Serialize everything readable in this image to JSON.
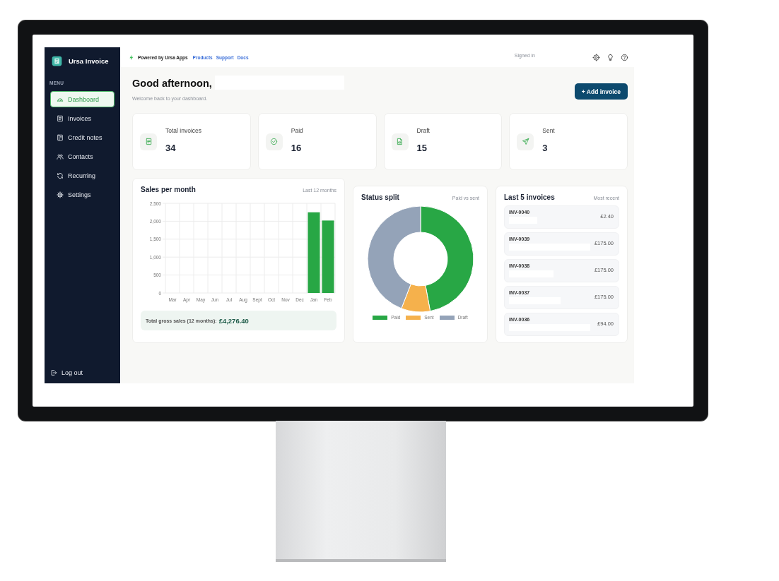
{
  "sidebar": {
    "app_name": "Ursa Invoice",
    "section_label": "MENU",
    "items": [
      {
        "label": "Dashboard",
        "selected": true
      },
      {
        "label": "Invoices",
        "selected": false
      },
      {
        "label": "Credit notes",
        "selected": false
      },
      {
        "label": "Contacts",
        "selected": false
      },
      {
        "label": "Recurring",
        "selected": false
      },
      {
        "label": "Settings",
        "selected": false
      }
    ],
    "logout": "Log out"
  },
  "top_bar": {
    "powered_by": "Powered by Ursa Apps",
    "links": [
      "Products",
      "Support",
      "Docs"
    ],
    "signed_in": "Signed in"
  },
  "header": {
    "greeting": "Good afternoon,",
    "subtitle": "Welcome back to your dashboard.",
    "add_button": "+ Add invoice"
  },
  "stats": [
    {
      "label": "Total invoices",
      "value": "34"
    },
    {
      "label": "Paid",
      "value": "16"
    },
    {
      "label": "Draft",
      "value": "15"
    },
    {
      "label": "Sent",
      "value": "3"
    }
  ],
  "sales": {
    "title": "Sales per month",
    "subtitle": "Last 12 months",
    "total_label": "Total gross sales (12 months):",
    "total_value": "£4,276.40",
    "chart_data": {
      "type": "bar",
      "categories": [
        "Mar",
        "Apr",
        "May",
        "Jun",
        "Jul",
        "Aug",
        "Sept",
        "Oct",
        "Nov",
        "Dec",
        "Jan",
        "Feb"
      ],
      "series": [
        {
          "color": "#28a745",
          "values": [
            0,
            0,
            0,
            0,
            0,
            0,
            0,
            0,
            0,
            0,
            2250,
            2020
          ]
        }
      ],
      "ylim": [
        0,
        2500
      ],
      "grid": true,
      "yticks": [
        {
          "value": 0,
          "label": "0"
        },
        {
          "value": 500,
          "label": "500"
        },
        {
          "value": 1000,
          "label": "1,000"
        },
        {
          "value": 1500,
          "label": "1,500"
        },
        {
          "value": 2000,
          "label": "2,000"
        },
        {
          "value": 2500,
          "label": "2,500"
        }
      ]
    }
  },
  "status": {
    "title": "Status split",
    "subtitle": "Paid vs sent",
    "chart_data": {
      "type": "donut",
      "categories": [
        "Paid",
        "Sent",
        "Draft"
      ],
      "series": [
        {
          "values": [
            47.1,
            8.8,
            44.1
          ]
        }
      ],
      "colors": [
        "#28a745",
        "#f5b14c",
        "#94a3b8"
      ],
      "legend": "bottom"
    }
  },
  "recent": {
    "title": "Last 5 invoices",
    "subtitle": "Most recent",
    "rows": [
      {
        "number": "INV-0040",
        "amount": "£2.40"
      },
      {
        "number": "INV-0039",
        "amount": "£175.00"
      },
      {
        "number": "INV-0038",
        "amount": "£175.00"
      },
      {
        "number": "INV-0037",
        "amount": "£175.00"
      },
      {
        "number": "INV-0036",
        "amount": "£94.00"
      }
    ]
  }
}
